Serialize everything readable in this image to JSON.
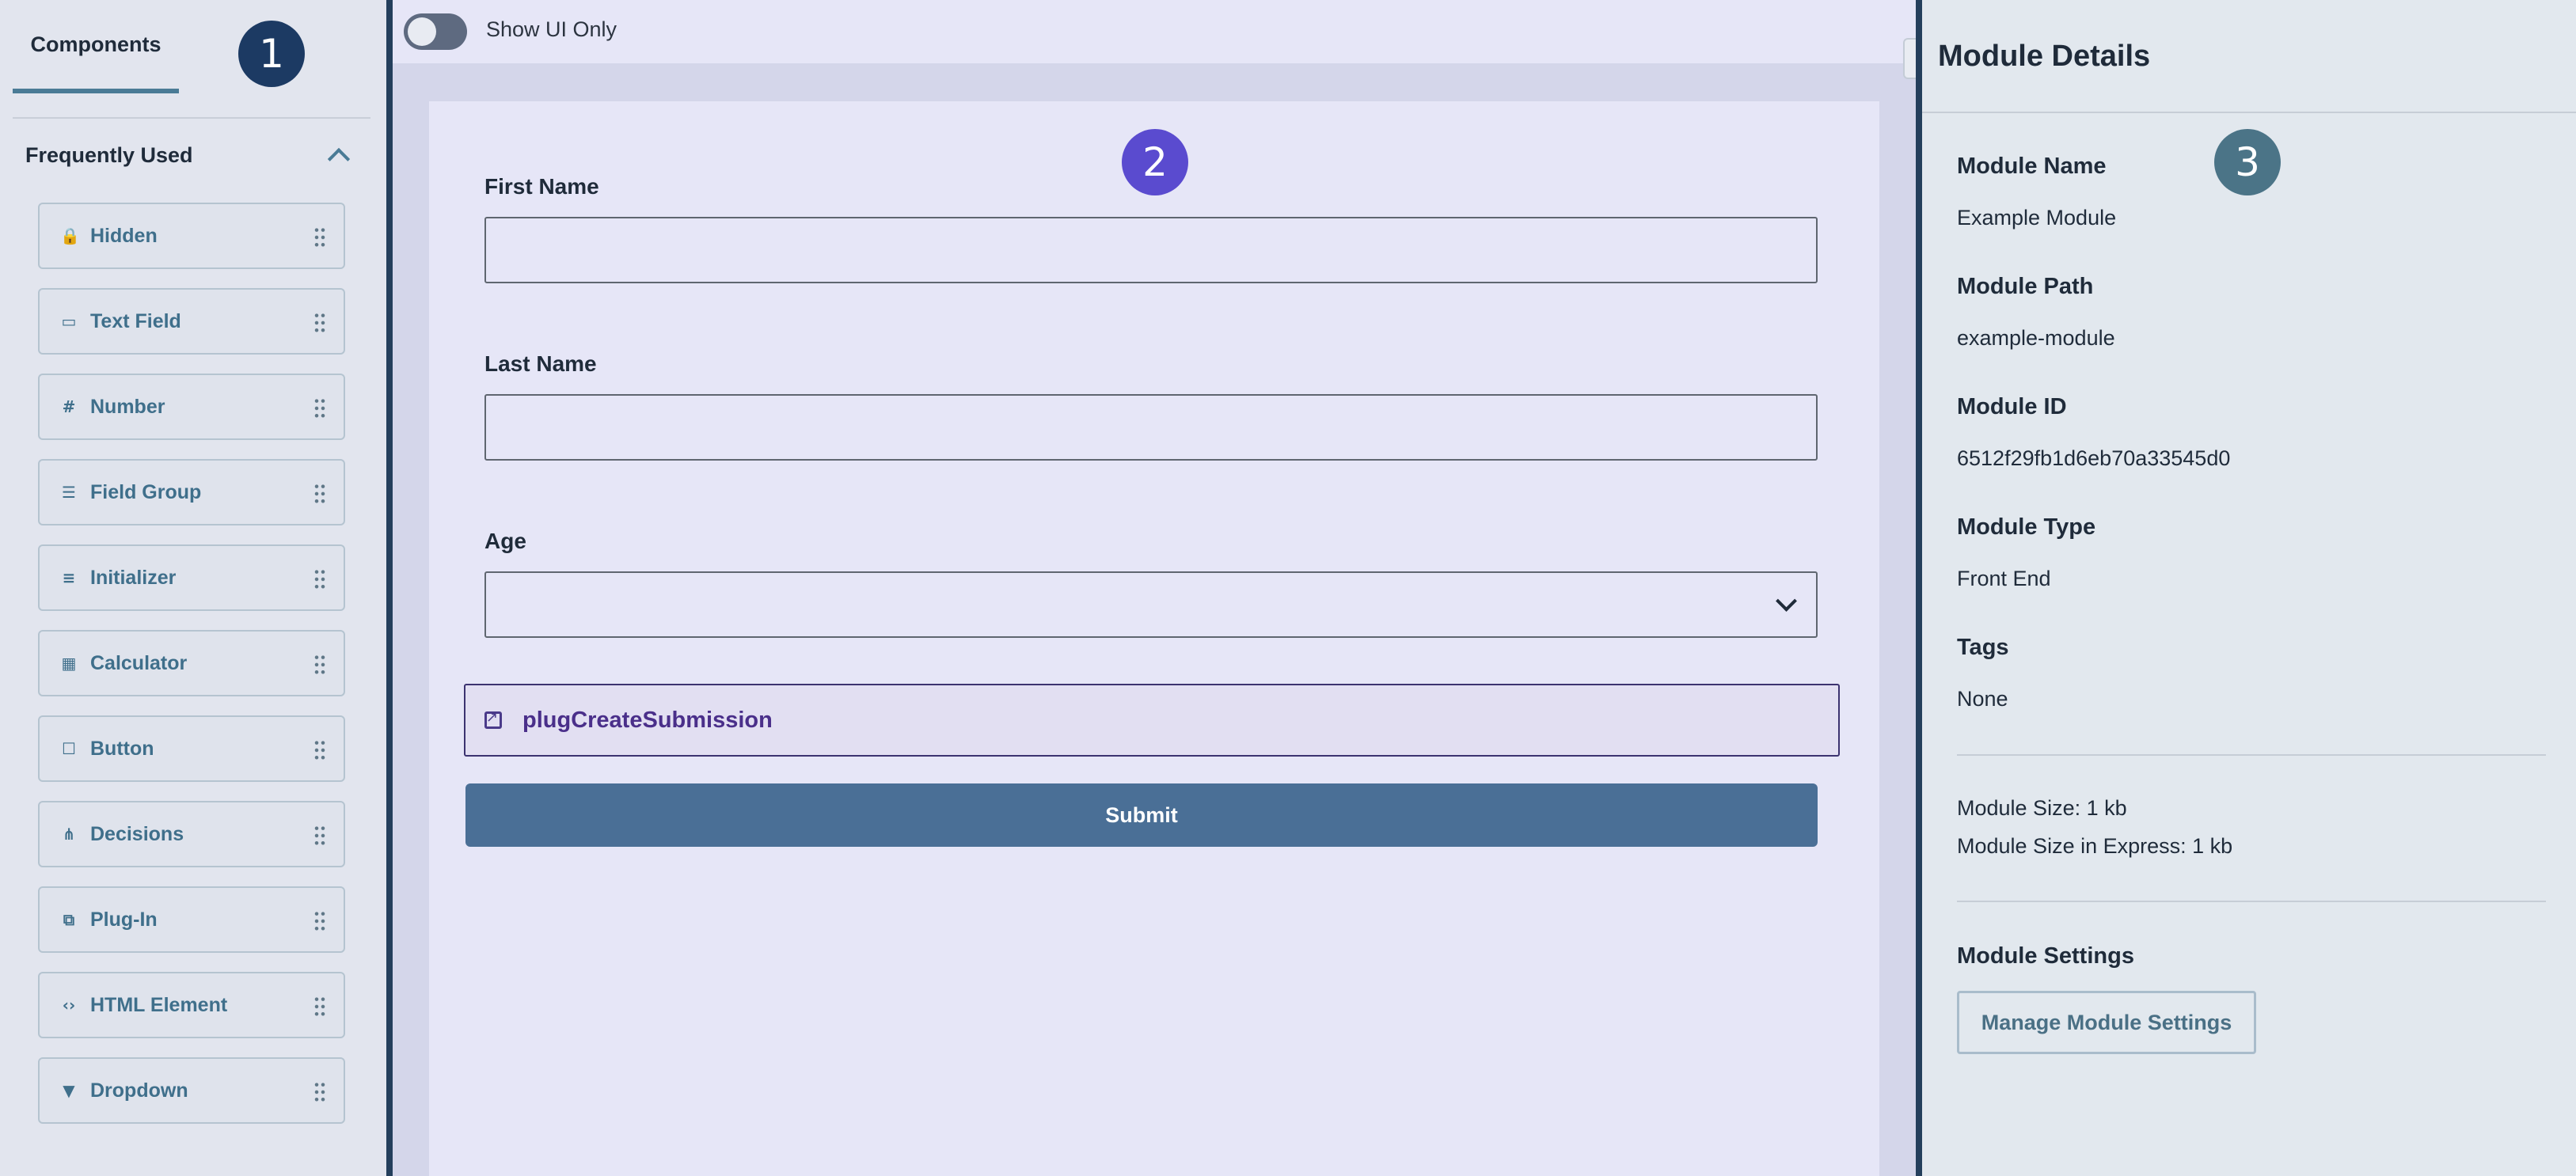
{
  "left_panel": {
    "tab_label": "Components",
    "section_title": "Frequently Used",
    "components": [
      {
        "label": "Hidden",
        "icon": "lock-icon",
        "glyph": "🔒"
      },
      {
        "label": "Text Field",
        "icon": "text-field-icon",
        "glyph": "▭"
      },
      {
        "label": "Number",
        "icon": "hash-icon",
        "glyph": "#"
      },
      {
        "label": "Field Group",
        "icon": "list-icon",
        "glyph": "☰"
      },
      {
        "label": "Initializer",
        "icon": "lines-icon",
        "glyph": "≡"
      },
      {
        "label": "Calculator",
        "icon": "calculator-icon",
        "glyph": "▦"
      },
      {
        "label": "Button",
        "icon": "button-icon",
        "glyph": "☐"
      },
      {
        "label": "Decisions",
        "icon": "decision-tree-icon",
        "glyph": "⋔"
      },
      {
        "label": "Plug-In",
        "icon": "plugin-icon",
        "glyph": "⧉"
      },
      {
        "label": "HTML Element",
        "icon": "code-icon",
        "glyph": "‹›"
      },
      {
        "label": "Dropdown",
        "icon": "dropdown-icon",
        "glyph": "▼"
      }
    ]
  },
  "badges": {
    "one": "1",
    "two": "2",
    "three": "3"
  },
  "center": {
    "toggle_label": "Show UI Only",
    "form": {
      "first_name_label": "First Name",
      "first_name_value": "",
      "last_name_label": "Last Name",
      "last_name_value": "",
      "age_label": "Age",
      "age_selected": "",
      "plugin_label": "plugCreateSubmission",
      "submit_label": "Submit"
    }
  },
  "right_panel": {
    "title": "Module Details",
    "module_name_label": "Module Name",
    "module_name": "Example Module",
    "module_path_label": "Module Path",
    "module_path": "example-module",
    "module_id_label": "Module ID",
    "module_id": "6512f29fb1d6eb70a33545d0",
    "module_type_label": "Module Type",
    "module_type": "Front End",
    "tags_label": "Tags",
    "tags": "None",
    "module_size": "Module Size: 1 kb",
    "module_size_express": "Module Size in Express: 1 kb",
    "settings_label": "Module Settings",
    "manage_button": "Manage Module Settings"
  },
  "colors": {
    "accent": "#4a7b96",
    "divider": "#243f5c",
    "submit": "#4a6f96",
    "plugin_text": "#4a2f8a"
  }
}
